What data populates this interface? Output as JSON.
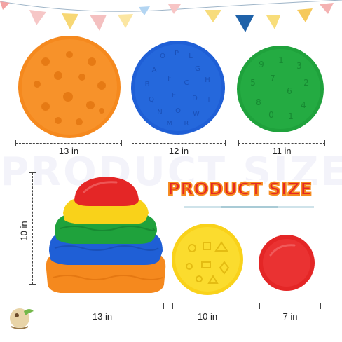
{
  "watermark": "PRODUCT SIZE",
  "title": "PRODUCT SIZE",
  "dimensions": {
    "orange_disc": "13 in",
    "blue_disc": "12 in",
    "green_disc": "11 in",
    "stack_height": "10 in",
    "stack_width": "13 in",
    "yellow_disc": "10 in",
    "red_dome": "7 in"
  },
  "disc_marks": {
    "blue": [
      "O",
      "P",
      "L",
      "A",
      "G",
      "H",
      "B",
      "F",
      "C",
      "Q",
      "E",
      "D",
      "I",
      "N",
      "O",
      "W",
      "M",
      "R"
    ],
    "green": [
      "9",
      "1",
      "3",
      "5",
      "2",
      "7",
      "6",
      "8",
      "4",
      "0",
      "1"
    ]
  },
  "colors": {
    "orange": "#f5891e",
    "blue": "#1f5fd6",
    "green": "#1fa23c",
    "yellow": "#f9d21a",
    "red": "#e42626"
  }
}
